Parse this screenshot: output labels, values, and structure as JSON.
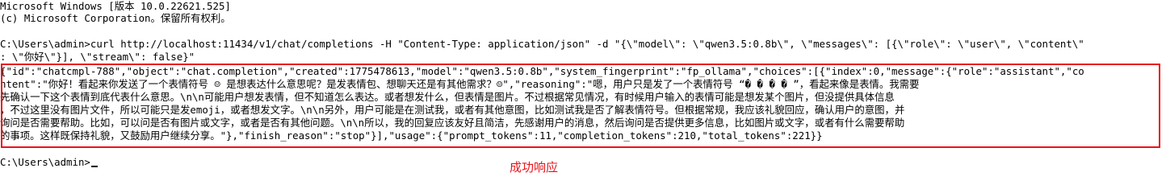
{
  "terminal": {
    "lines": [
      "Microsoft Windows [版本 10.0.22621.525]",
      "(c) Microsoft Corporation。保留所有权利。",
      "",
      "C:\\Users\\admin>curl http://localhost:11434/v1/chat/completions -H \"Content-Type: application/json\" -d \"{\\\"model\\\": \\\"qwen3.5:0.8b\\\", \\\"messages\\\": [{\\\"role\\\": \\\"user\\\", \\\"content\\\"",
      ": \\\"你好\\\"}], \\\"stream\\\": false}\"",
      "{\"id\":\"chatcmpl-788\",\"object\":\"chat.completion\",\"created\":1775478613,\"model\":\"qwen3.5:0.8b\",\"system_fingerprint\":\"fp_ollama\",\"choices\":[{\"index\":0,\"message\":{\"role\":\"assistant\",\"co",
      "ntent\":\"你好！看起来你发送了一个表情符号 ☺ 是想表达什么意思呢？是发表情包、想聊天还是有其他需求？☺\",\"reasoning\":\"嗯，用户只是发了一个表情符号 “� � � � ”，看起来像是表情。我需要",
      "先确认一下这个表情到底代表什么意思。\\n\\n可能用户想发表情，但不知道怎么表达。或者想发什么，但表情是图片。不过根据常见情况，有时候用户输入的表情可能是想发某个图片，但没提供具体信息",
      "，不过这里没有图片文件，所以可能只是发emoji，或者想发文字。\\n\\n另外，用户可能是在测试我，或者有其他意图，比如测试我是否了解表情符号。但根据常规，我应该礼貌回应，确认用户的意图，并",
      "询问是否需要帮助。比如，可以问是否有图片或文字，或者是否有其他问题。\\n\\n所以，我的回复应该友好且简洁，先感谢用户的消息，然后询问是否提供更多信息，比如图片或文字，或者有什么需要帮助",
      "的事项。这样既保持礼貌，又鼓励用户继续分享。\"},\"finish_reason\":\"stop\"}],\"usage\":{\"prompt_tokens\":11,\"completion_tokens\":210,\"total_tokens\":221}}",
      "",
      "C:\\Users\\admin>"
    ]
  },
  "annotation": {
    "label": "成功响应",
    "color": "#e8131a"
  }
}
